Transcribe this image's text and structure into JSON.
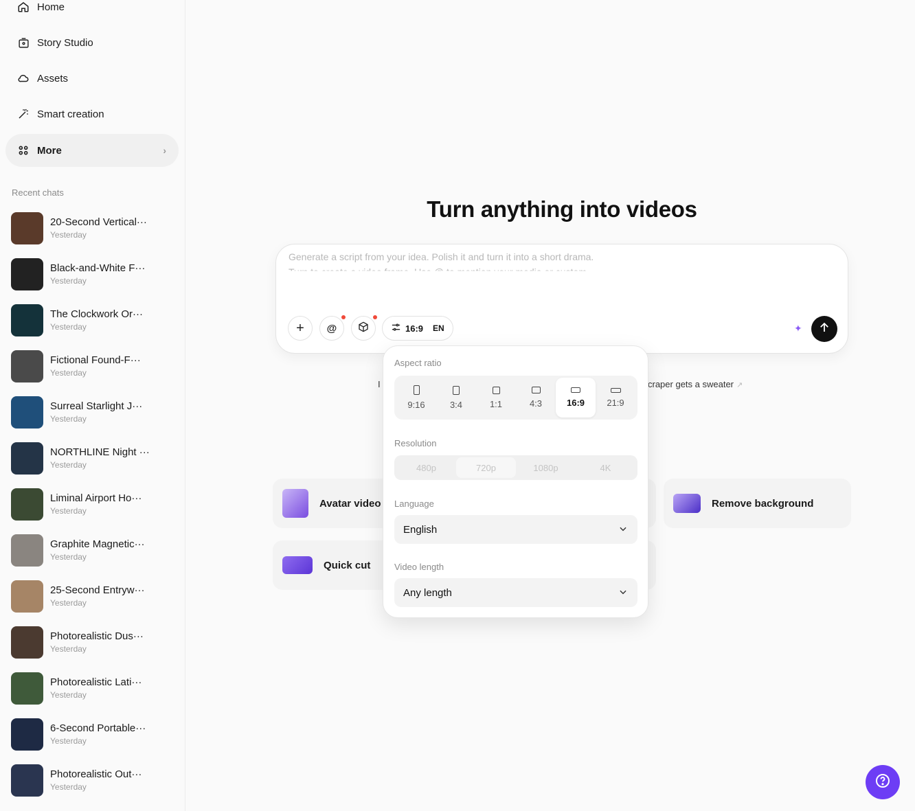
{
  "nav": {
    "home": "Home",
    "story_studio": "Story Studio",
    "assets": "Assets",
    "smart_creation": "Smart creation",
    "more": "More"
  },
  "recent_label": "Recent chats",
  "chats": [
    {
      "title": "20-Second Vertical···",
      "date": "Yesterday"
    },
    {
      "title": "Black-and-White F···",
      "date": "Yesterday"
    },
    {
      "title": "The Clockwork Or···",
      "date": "Yesterday"
    },
    {
      "title": "Fictional Found-F···",
      "date": "Yesterday"
    },
    {
      "title": "Surreal Starlight J···",
      "date": "Yesterday"
    },
    {
      "title": "NORTHLINE Night ···",
      "date": "Yesterday"
    },
    {
      "title": "Liminal Airport Ho···",
      "date": "Yesterday"
    },
    {
      "title": "Graphite Magnetic···",
      "date": "Yesterday"
    },
    {
      "title": "25-Second Entryw···",
      "date": "Yesterday"
    },
    {
      "title": "Photorealistic Dus···",
      "date": "Yesterday"
    },
    {
      "title": "Photorealistic Lati···",
      "date": "Yesterday"
    },
    {
      "title": "6-Second Portable···",
      "date": "Yesterday"
    },
    {
      "title": "Photorealistic Out···",
      "date": "Yesterday"
    }
  ],
  "thumb_colors": [
    "#5a3a2a",
    "#222222",
    "#14323a",
    "#4a4a4a",
    "#1f4f7a",
    "#243447",
    "#3b4a33",
    "#8a8580",
    "#a68566",
    "#4b3a30",
    "#3f5a3a",
    "#1e2a44",
    "#2a3550"
  ],
  "headline": "Turn anything into videos",
  "prompt": {
    "placeholder_line1": "Generate a script from your idea. Polish it and turn it into a short drama.",
    "placeholder_line2": "Turn to create a video frame. Use @ to mention your media or custom"
  },
  "toolbar": {
    "add": "+",
    "mention": "@",
    "ratio_value": "16:9",
    "language_code": "EN"
  },
  "suggestions": {
    "left": "I",
    "right": "craper gets a sweater",
    "right_arrow": "↗"
  },
  "cards": {
    "avatar_video": "Avatar video",
    "quick_cut": "Quick cut",
    "remove_background": "Remove background"
  },
  "popover": {
    "aspect_ratio_label": "Aspect ratio",
    "ratios": [
      "9:16",
      "3:4",
      "1:1",
      "4:3",
      "16:9",
      "21:9"
    ],
    "selected_ratio": "16:9",
    "resolution_label": "Resolution",
    "resolutions": [
      "480p",
      "720p",
      "1080p",
      "4K"
    ],
    "selected_resolution": "720p",
    "language_label": "Language",
    "language_value": "English",
    "length_label": "Video length",
    "length_value": "Any length"
  },
  "colors": {
    "accent": "#6d3df5",
    "notification_dot": "#f04a3a",
    "sparkle": "#8b5cf6"
  }
}
